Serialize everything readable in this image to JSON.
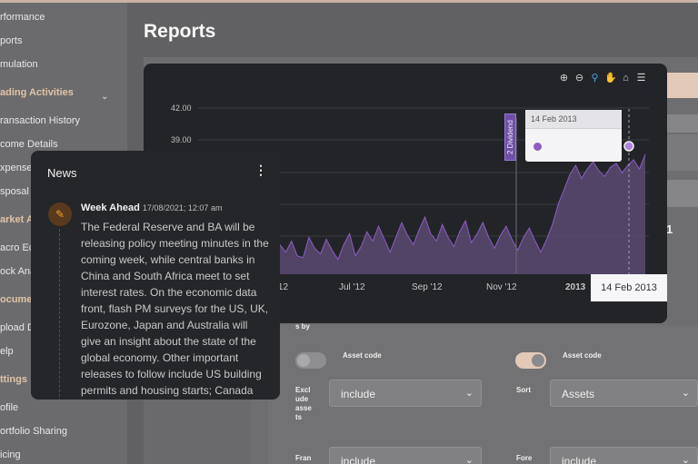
{
  "sidebar": {
    "items": [
      "rformance",
      "ports",
      "mulation",
      "ransaction History",
      "come Details",
      "xpense",
      "sposal",
      "acro Ec",
      "ock Ana",
      "pload D",
      "elp",
      "ofile",
      "ortfolio Sharing",
      "icing"
    ],
    "sections": [
      "ading Activities",
      "arket A",
      "ocumen",
      "ttings"
    ],
    "chevron_icon": "chevron-down-icon"
  },
  "page": {
    "title": "Reports"
  },
  "chart": {
    "toolbar_icons": [
      "zoom-in-icon",
      "zoom-out-icon",
      "magnifier-icon",
      "pan-hand-icon",
      "home-icon",
      "menu-icon"
    ],
    "dividend_label": "2 Dividend",
    "tooltip_header": "14 Feb 2013",
    "crosshair_label": "14 Feb 2013",
    "accent": "#8e5cc4"
  },
  "chart_data": {
    "type": "area",
    "y_ticks": [
      "42.00",
      "39.00"
    ],
    "x_ticks": [
      "'12",
      "Jul '12",
      "Sep '12",
      "Nov '12",
      "2013"
    ],
    "ylim": [
      33,
      42
    ],
    "values": [
      34.6,
      34.2,
      34.8,
      34.0,
      33.9,
      35.0,
      34.4,
      34.1,
      34.9,
      34.3,
      33.8,
      34.6,
      35.2,
      34.0,
      34.5,
      35.3,
      34.8,
      35.6,
      34.9,
      34.2,
      35.0,
      35.8,
      35.1,
      34.6,
      35.4,
      36.1,
      35.2,
      34.8,
      35.7,
      35.0,
      34.5,
      35.3,
      35.9,
      34.7,
      35.2,
      35.8,
      35.0,
      34.4,
      35.1,
      35.6,
      34.9,
      34.3,
      35.0,
      35.5,
      34.8,
      34.2,
      34.9,
      35.7,
      36.8,
      37.6,
      38.4,
      38.9,
      38.2,
      38.7,
      39.1,
      38.6,
      38.3,
      38.8,
      39.0,
      38.5,
      38.9,
      39.2,
      38.7,
      39.5
    ]
  },
  "news": {
    "title": "News",
    "menu_icon": "kebab-menu-icon",
    "avatar_icon": "pencil-icon",
    "item_title": "Week Ahead",
    "item_time": "17/08/2021; 12:07 am",
    "item_body": "The Federal Reserve and BA will be releasing policy meeting minutes in the coming week, while central banks in China and South Africa meet to set interest rates. On the economic data front, flash PM surveys for the US, UK, Eurozone, Japan and Australia will give an insight about the state of the global economy. Other important releases to follow include US building permits and housing starts; Canada"
  },
  "filters": {
    "sort_by_fragment": "s by",
    "asset_code_left": "Asset code",
    "asset_code_right": "Asset code",
    "exclude_assets_label": "Excl ude asse ts",
    "exclude_select": "include",
    "sort_label": "Sort",
    "sort_select": "Assets",
    "fran_label": "Fran",
    "fran_select": "include",
    "fore_label": "Fore",
    "fore_select": "include",
    "side_digit": "1",
    "toggle_on_color": "#e3c9b8"
  }
}
